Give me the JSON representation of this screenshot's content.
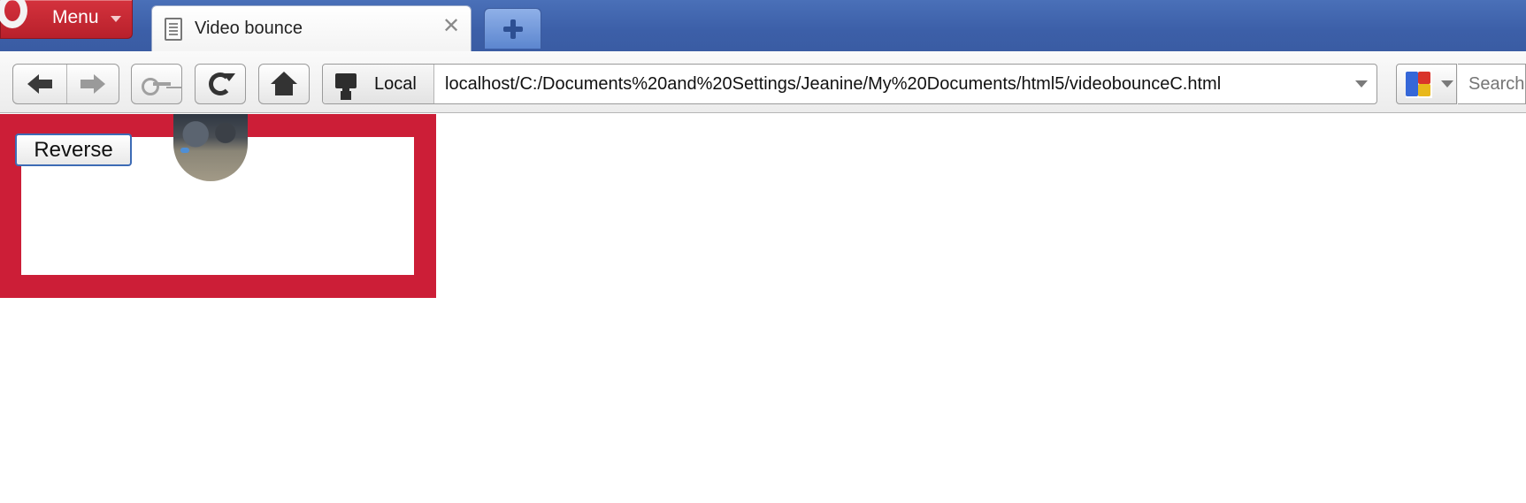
{
  "browser": {
    "menu_label": "Menu",
    "tab": {
      "title": "Video bounce"
    },
    "address_bar": {
      "security_badge": "Local",
      "url": "localhost/C:/Documents%20and%20Settings/Jeanine/My%20Documents/html5/videobounceC.html"
    },
    "search": {
      "placeholder": "Search"
    }
  },
  "page": {
    "reverse_button_label": "Reverse",
    "canvas_border_color": "#cc1e37"
  }
}
